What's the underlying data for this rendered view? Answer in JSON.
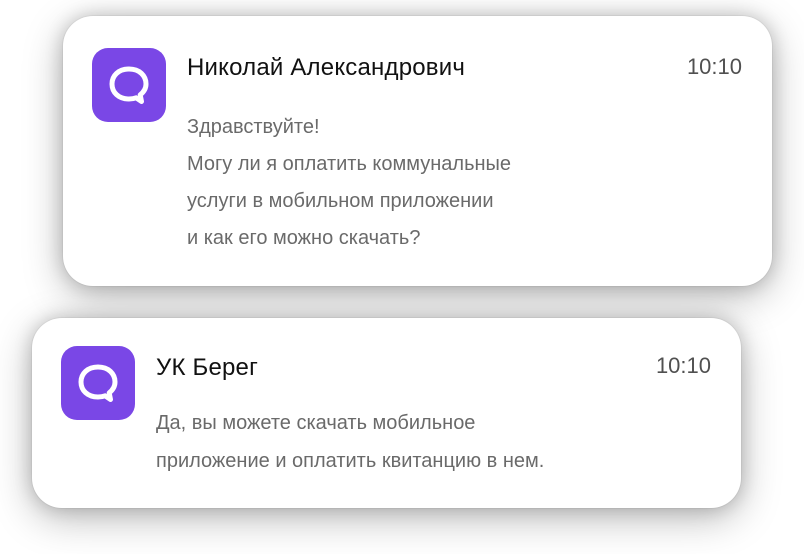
{
  "notifications": [
    {
      "icon": "chat-bubble-icon",
      "sender": "Николай Александрович",
      "time": "10:10",
      "lines": [
        "Здравствуйте!",
        "Могу ли я оплатить коммунальные",
        "услуги в мобильном приложении",
        "и как его можно скачать?"
      ]
    },
    {
      "icon": "chat-bubble-icon",
      "sender": "УК Берег",
      "time": "10:10",
      "lines": [
        "Да, вы можете скачать мобильное",
        "приложение и оплатить квитанцию в нем."
      ]
    }
  ],
  "colors": {
    "icon_background": "#7a47e6",
    "card_background": "#ffffff"
  }
}
